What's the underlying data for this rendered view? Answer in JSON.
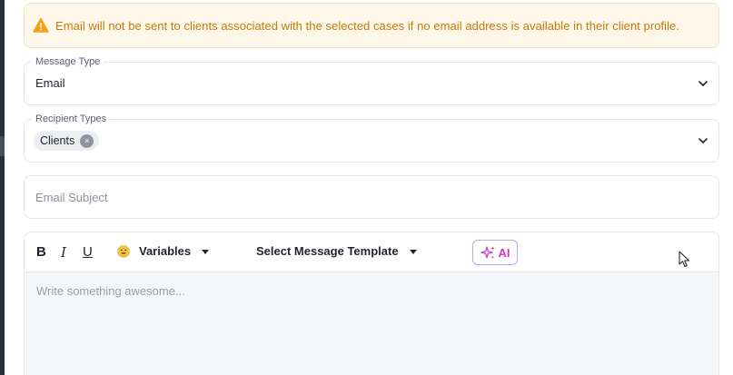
{
  "alert": {
    "message": "Email will not be sent to clients associated with the selected cases if no email address is available in their client profile.",
    "icon": "warning-triangle-icon",
    "color": "#c47a07"
  },
  "message_type": {
    "label": "Message Type",
    "value": "Email"
  },
  "recipient_types": {
    "label": "Recipient Types",
    "chips": [
      {
        "label": "Clients",
        "remove": "×"
      }
    ]
  },
  "email_subject": {
    "placeholder": "Email Subject",
    "value": ""
  },
  "editor": {
    "toolbar": {
      "bold": "B",
      "italic": "I",
      "underline": "U",
      "variables_label": "Variables",
      "template_label": "Select Message Template",
      "ai_label": "AI"
    },
    "placeholder": "Write something awesome..."
  },
  "colors": {
    "ai_accent": "#d93cb6",
    "warning_bg": "#fff8ea"
  }
}
